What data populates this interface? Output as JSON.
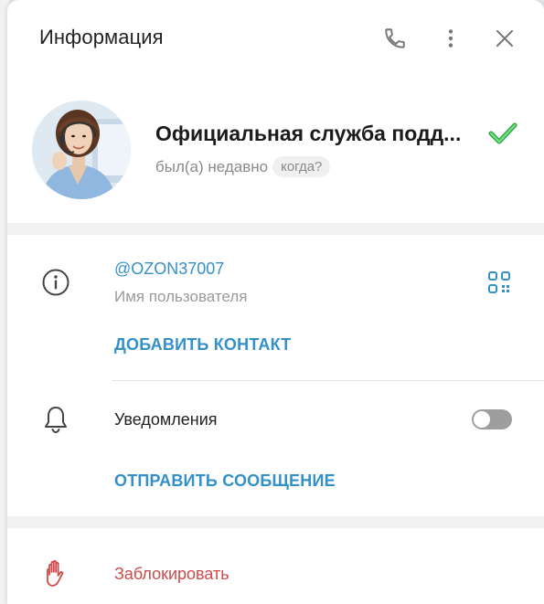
{
  "panel": {
    "title": "Информация"
  },
  "header_icons": {
    "call": "phone-icon",
    "more": "more-vertical-icon",
    "close": "close-icon"
  },
  "profile": {
    "name": "Официальная служба подд...",
    "status": "был(а) недавно",
    "when_chip": "когда?",
    "verified_color": "#4cd964"
  },
  "info": {
    "username": "@OZON37007",
    "username_caption": "Имя пользователя",
    "add_contact": "ДОБАВИТЬ КОНТАКТ",
    "notifications_label": "Уведомления",
    "notifications_enabled": false,
    "send_message": "ОТПРАВИТЬ СООБЩЕНИЕ"
  },
  "danger": {
    "block_label": "Заблокировать",
    "color": "#cf4a4a"
  },
  "colors": {
    "accent": "#3390c9",
    "danger": "#cf4a4a",
    "verified": "#4cd964"
  }
}
